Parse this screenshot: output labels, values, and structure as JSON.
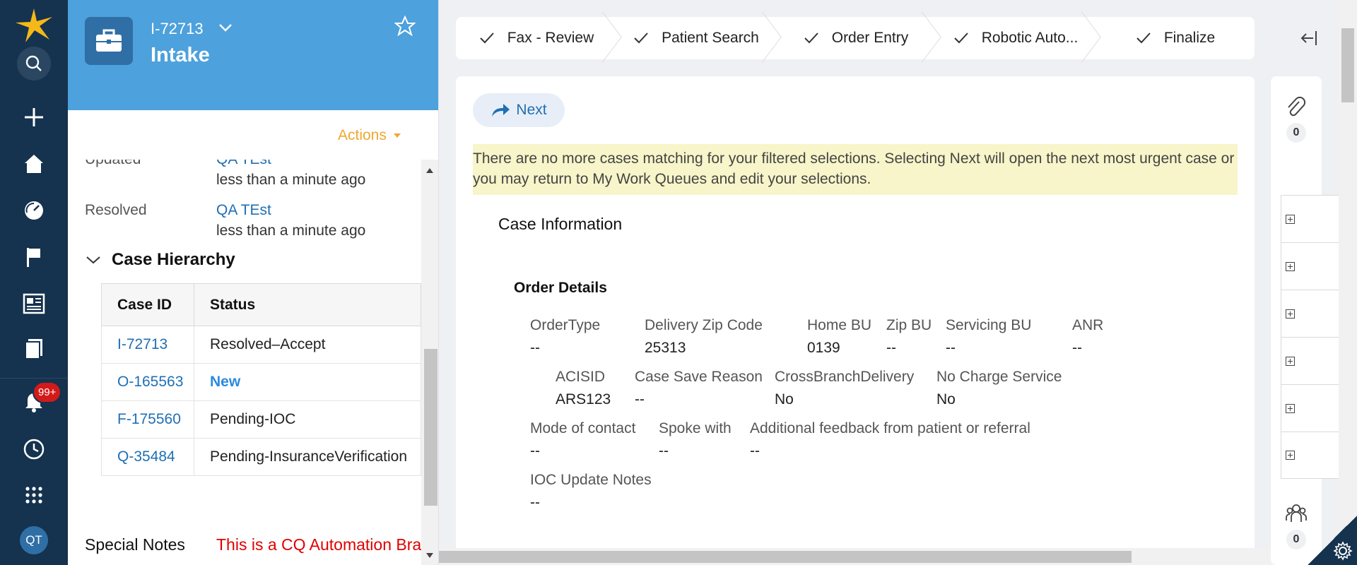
{
  "rail": {
    "notifications_badge": "99+",
    "avatar_initials": "QT",
    "icons": [
      "logo-icon",
      "search-icon",
      "plus-icon",
      "home-icon",
      "dashboard-icon",
      "flag-icon",
      "news-icon",
      "documents-icon",
      "bell-icon",
      "history-icon",
      "apps-grid-icon"
    ]
  },
  "case": {
    "id": "I-72713",
    "title": "Intake",
    "actions_label": "Actions",
    "updated_label": "Updated",
    "updated_user": "QA TEst",
    "updated_time": "less than a minute ago",
    "resolved_label": "Resolved",
    "resolved_user": "QA TEst",
    "resolved_time": "less than a minute ago",
    "hierarchy_title": "Case Hierarchy",
    "hierarchy_headers": [
      "Case ID",
      "Status"
    ],
    "hierarchy_rows": [
      {
        "id": "I-72713",
        "status": "Resolved–Accept"
      },
      {
        "id": "O-165563",
        "status": "New"
      },
      {
        "id": "F-175560",
        "status": "Pending-IOC"
      },
      {
        "id": "Q-35484",
        "status": "Pending-InsuranceVerification"
      }
    ],
    "special_notes_label": "Special Notes",
    "special_notes_value": "This is a CQ Automation Branch"
  },
  "stages": [
    "Fax - Review",
    "Patient Search",
    "Order Entry",
    "Robotic Auto...",
    "Finalize"
  ],
  "main": {
    "next_label": "Next",
    "banner": "There are no more cases matching for your filtered selections. Selecting Next will open the next most urgent case or you may return to My Work Queues and edit your selections.",
    "section_title": "Case Information",
    "order_details_title": "Order Details",
    "fields": {
      "order_type": {
        "label": "OrderType",
        "value": "--"
      },
      "delivery_zip": {
        "label": "Delivery Zip Code",
        "value": "25313"
      },
      "home_bu": {
        "label": "Home BU",
        "value": "0139"
      },
      "zip_bu": {
        "label": "Zip BU",
        "value": "--"
      },
      "servicing_bu": {
        "label": "Servicing BU",
        "value": "--"
      },
      "anr": {
        "label": "ANR",
        "value": "--"
      },
      "acisid": {
        "label": "ACISID",
        "value": "ARS123"
      },
      "case_save_reason": {
        "label": "Case Save Reason",
        "value": "--"
      },
      "cross_branch": {
        "label": "CrossBranchDelivery",
        "value": "No"
      },
      "no_charge": {
        "label": "No Charge Service",
        "value": "No"
      },
      "mode_contact": {
        "label": "Mode of contact",
        "value": "--"
      },
      "spoke_with": {
        "label": "Spoke with",
        "value": "--"
      },
      "feedback": {
        "label": "Additional feedback from patient or referral",
        "value": "--"
      },
      "ioc_notes": {
        "label": "IOC Update Notes",
        "value": "--"
      }
    }
  },
  "utility": {
    "attachments_count": "0",
    "followers_count": "0",
    "accordion_count": 6
  },
  "colors": {
    "rail": "#15324e",
    "header": "#4da1dc",
    "link": "#1f6fb4",
    "actions": "#f0a730",
    "alert_text": "#e00000",
    "banner": "#f7f5c9"
  }
}
